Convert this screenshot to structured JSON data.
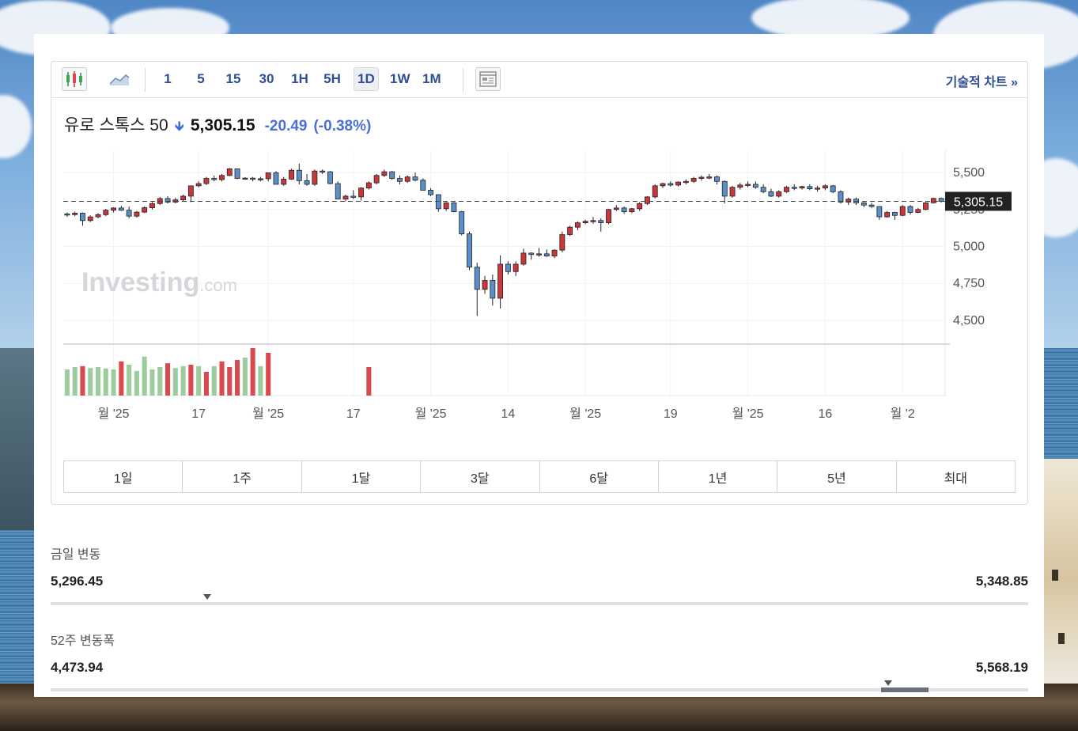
{
  "toolbar": {
    "intervals": [
      "1",
      "5",
      "15",
      "30",
      "1H",
      "5H",
      "1D",
      "1W",
      "1M"
    ],
    "active_interval": "1D",
    "tech_chart_label": "기술적 차트 »"
  },
  "quote": {
    "name": "유로 스톡스 50",
    "direction": "down",
    "last": "5,305.15",
    "change": "-20.49",
    "change_pct": "(-0.38%)"
  },
  "watermark": {
    "brand": "Investing",
    "suffix": ".com"
  },
  "ranges": [
    "1일",
    "1주",
    "1달",
    "3달",
    "6달",
    "1년",
    "5년",
    "최대"
  ],
  "stats": {
    "day": {
      "label": "금일 변동",
      "low": "5,296.45",
      "high": "5,348.85",
      "current_pct": 0.16
    },
    "week52": {
      "label": "52주 변동폭",
      "low": "4,473.94",
      "high": "5,568.19",
      "current_pct": 0.857
    }
  },
  "colors": {
    "up": "#c9373a",
    "down": "#5b8fcb",
    "vol_up": "#d9494e",
    "vol_down": "#9ccc9b",
    "accent": "#2f4e96"
  },
  "chart_data": {
    "type": "candlestick",
    "y_ticks": [
      "5,500",
      "5,250",
      "5,000",
      "4,750",
      "4,500"
    ],
    "y_tick_values": [
      5500,
      5250,
      5000,
      4750,
      4500
    ],
    "ylim": [
      4350,
      5650
    ],
    "last_price_label": "5,305.15",
    "last_price": 5305.15,
    "x_ticks": [
      "월 '25",
      "17",
      "월 '25",
      "17",
      "월 '25",
      "14",
      "월 '25",
      "19",
      "월 '25",
      "16",
      "월 '2"
    ],
    "x_tick_index": [
      6,
      17,
      26,
      37,
      47,
      57,
      67,
      78,
      88,
      98,
      108
    ],
    "candles": [
      [
        5220,
        5230,
        5200,
        5215
      ],
      [
        5215,
        5235,
        5205,
        5225
      ],
      [
        5225,
        5230,
        5140,
        5175
      ],
      [
        5175,
        5210,
        5165,
        5200
      ],
      [
        5200,
        5225,
        5190,
        5215
      ],
      [
        5215,
        5255,
        5205,
        5245
      ],
      [
        5245,
        5265,
        5230,
        5260
      ],
      [
        5260,
        5275,
        5240,
        5245
      ],
      [
        5245,
        5270,
        5190,
        5205
      ],
      [
        5205,
        5240,
        5195,
        5232
      ],
      [
        5232,
        5270,
        5225,
        5262
      ],
      [
        5262,
        5300,
        5250,
        5290
      ],
      [
        5290,
        5335,
        5280,
        5324
      ],
      [
        5324,
        5340,
        5290,
        5300
      ],
      [
        5300,
        5330,
        5292,
        5315
      ],
      [
        5315,
        5350,
        5305,
        5340
      ],
      [
        5340,
        5360,
        5300,
        5410
      ],
      [
        5410,
        5440,
        5400,
        5425
      ],
      [
        5425,
        5470,
        5415,
        5460
      ],
      [
        5460,
        5480,
        5440,
        5452
      ],
      [
        5452,
        5490,
        5440,
        5480
      ],
      [
        5480,
        5530,
        5475,
        5525
      ],
      [
        5525,
        5520,
        5455,
        5460
      ],
      [
        5460,
        5468,
        5455,
        5462
      ],
      [
        5462,
        5470,
        5440,
        5455
      ],
      [
        5455,
        5470,
        5440,
        5458
      ],
      [
        5458,
        5500,
        5440,
        5498
      ],
      [
        5498,
        5510,
        5420,
        5420
      ],
      [
        5420,
        5470,
        5410,
        5455
      ],
      [
        5455,
        5525,
        5450,
        5515
      ],
      [
        5515,
        5560,
        5420,
        5445
      ],
      [
        5445,
        5490,
        5410,
        5420
      ],
      [
        5420,
        5520,
        5410,
        5510
      ],
      [
        5510,
        5520,
        5490,
        5505
      ],
      [
        5505,
        5510,
        5420,
        5425
      ],
      [
        5425,
        5440,
        5320,
        5320
      ],
      [
        5320,
        5350,
        5305,
        5340
      ],
      [
        5340,
        5380,
        5320,
        5335
      ],
      [
        5335,
        5400,
        5310,
        5395
      ],
      [
        5395,
        5440,
        5385,
        5430
      ],
      [
        5430,
        5490,
        5420,
        5480
      ],
      [
        5480,
        5520,
        5470,
        5505
      ],
      [
        5505,
        5510,
        5450,
        5460
      ],
      [
        5460,
        5480,
        5420,
        5440
      ],
      [
        5440,
        5480,
        5430,
        5470
      ],
      [
        5470,
        5500,
        5440,
        5448
      ],
      [
        5448,
        5460,
        5380,
        5380
      ],
      [
        5380,
        5395,
        5340,
        5350
      ],
      [
        5350,
        5345,
        5235,
        5255
      ],
      [
        5255,
        5300,
        5240,
        5295
      ],
      [
        5295,
        5300,
        5230,
        5235
      ],
      [
        5235,
        5240,
        5075,
        5085
      ],
      [
        5085,
        5100,
        4840,
        4860
      ],
      [
        4860,
        4890,
        4530,
        4710
      ],
      [
        4710,
        4800,
        4680,
        4770
      ],
      [
        4770,
        4810,
        4600,
        4650
      ],
      [
        4650,
        4940,
        4580,
        4880
      ],
      [
        4880,
        4900,
        4810,
        4830
      ],
      [
        4830,
        4900,
        4800,
        4880
      ],
      [
        4880,
        4985,
        4870,
        4955
      ],
      [
        4955,
        4960,
        4910,
        4945
      ],
      [
        4945,
        4990,
        4930,
        4950
      ],
      [
        4950,
        4980,
        4930,
        4935
      ],
      [
        4935,
        4980,
        4920,
        4975
      ],
      [
        4975,
        5100,
        4960,
        5080
      ],
      [
        5080,
        5140,
        5070,
        5130
      ],
      [
        5130,
        5170,
        5110,
        5160
      ],
      [
        5160,
        5180,
        5150,
        5170
      ],
      [
        5170,
        5200,
        5155,
        5175
      ],
      [
        5175,
        5190,
        5100,
        5160
      ],
      [
        5160,
        5255,
        5150,
        5250
      ],
      [
        5250,
        5280,
        5240,
        5260
      ],
      [
        5260,
        5270,
        5220,
        5235
      ],
      [
        5235,
        5260,
        5225,
        5255
      ],
      [
        5255,
        5300,
        5240,
        5290
      ],
      [
        5290,
        5340,
        5280,
        5335
      ],
      [
        5335,
        5420,
        5325,
        5410
      ],
      [
        5410,
        5430,
        5395,
        5425
      ],
      [
        5425,
        5440,
        5405,
        5415
      ],
      [
        5415,
        5440,
        5405,
        5435
      ],
      [
        5435,
        5455,
        5420,
        5440
      ],
      [
        5440,
        5470,
        5430,
        5460
      ],
      [
        5460,
        5480,
        5445,
        5468
      ],
      [
        5468,
        5490,
        5455,
        5470
      ],
      [
        5470,
        5480,
        5420,
        5440
      ],
      [
        5440,
        5445,
        5290,
        5340
      ],
      [
        5340,
        5410,
        5330,
        5400
      ],
      [
        5400,
        5430,
        5385,
        5415
      ],
      [
        5415,
        5440,
        5400,
        5420
      ],
      [
        5420,
        5440,
        5390,
        5400
      ],
      [
        5400,
        5420,
        5360,
        5370
      ],
      [
        5370,
        5390,
        5335,
        5340
      ],
      [
        5340,
        5380,
        5330,
        5370
      ],
      [
        5370,
        5410,
        5360,
        5400
      ],
      [
        5400,
        5420,
        5380,
        5395
      ],
      [
        5395,
        5410,
        5385,
        5405
      ],
      [
        5405,
        5420,
        5380,
        5390
      ],
      [
        5390,
        5410,
        5370,
        5395
      ],
      [
        5395,
        5420,
        5380,
        5410
      ],
      [
        5410,
        5415,
        5360,
        5370
      ],
      [
        5370,
        5380,
        5290,
        5300
      ],
      [
        5300,
        5330,
        5280,
        5320
      ],
      [
        5320,
        5330,
        5280,
        5295
      ],
      [
        5295,
        5300,
        5265,
        5280
      ],
      [
        5280,
        5295,
        5260,
        5270
      ],
      [
        5270,
        5260,
        5180,
        5200
      ],
      [
        5200,
        5240,
        5195,
        5230
      ],
      [
        5230,
        5235,
        5180,
        5210
      ],
      [
        5210,
        5280,
        5205,
        5270
      ],
      [
        5270,
        5280,
        5215,
        5230
      ],
      [
        5230,
        5260,
        5225,
        5250
      ],
      [
        5250,
        5300,
        5245,
        5295
      ],
      [
        5295,
        5330,
        5290,
        5325
      ],
      [
        5325,
        5330,
        5296,
        5305
      ]
    ],
    "volume": [
      [
        0.55,
        0
      ],
      [
        0.6,
        0
      ],
      [
        0.62,
        1
      ],
      [
        0.58,
        0
      ],
      [
        0.6,
        0
      ],
      [
        0.57,
        0
      ],
      [
        0.55,
        0
      ],
      [
        0.72,
        1
      ],
      [
        0.65,
        0
      ],
      [
        0.52,
        0
      ],
      [
        0.82,
        0
      ],
      [
        0.55,
        0
      ],
      [
        0.6,
        0
      ],
      [
        0.68,
        1
      ],
      [
        0.58,
        0
      ],
      [
        0.62,
        0
      ],
      [
        0.65,
        1
      ],
      [
        0.62,
        0
      ],
      [
        0.5,
        1
      ],
      [
        0.62,
        0
      ],
      [
        0.72,
        1
      ],
      [
        0.6,
        1
      ],
      [
        0.75,
        1
      ],
      [
        0.8,
        0
      ],
      [
        1.0,
        1
      ],
      [
        0.62,
        0
      ],
      [
        0.9,
        1
      ],
      [
        0,
        0
      ],
      [
        0,
        0
      ],
      [
        0,
        0
      ],
      [
        0,
        0
      ],
      [
        0,
        0
      ],
      [
        0,
        0
      ],
      [
        0,
        0
      ],
      [
        0,
        0
      ],
      [
        0,
        0
      ],
      [
        0,
        0
      ],
      [
        0,
        0
      ],
      [
        0,
        0
      ],
      [
        0.6,
        1
      ]
    ]
  }
}
